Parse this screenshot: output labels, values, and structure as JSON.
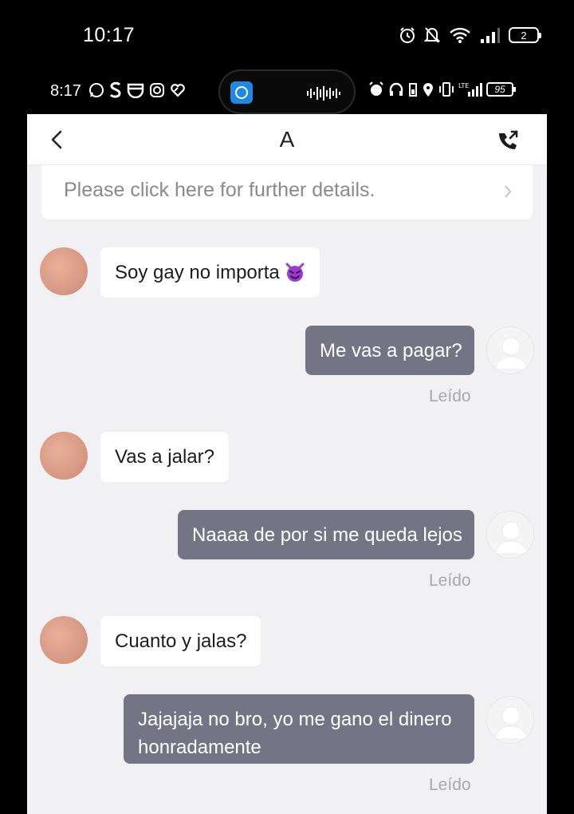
{
  "outer_status": {
    "time": "10:17",
    "battery_level": "2"
  },
  "inner_status": {
    "time": "8:17",
    "battery_level": "95"
  },
  "header": {
    "title": "A"
  },
  "notice": {
    "text": "Please click here for further details."
  },
  "messages": [
    {
      "direction": "in",
      "text": "Soy gay no importa",
      "emoji": "smiling-imp-emoji"
    },
    {
      "direction": "out",
      "text": "Me vas a pagar?",
      "status": "Leído"
    },
    {
      "direction": "in",
      "text": "Vas a jalar?"
    },
    {
      "direction": "out",
      "text": "Naaaa de por si me queda lejos",
      "status": "Leído"
    },
    {
      "direction": "in",
      "text": "Cuanto y jalas?"
    },
    {
      "direction": "out",
      "text": "Jajajaja no bro, yo me gano el dinero honradamente",
      "status": "Leído"
    }
  ],
  "colors": {
    "outgoing_bubble": "#747584",
    "incoming_bubble": "#ffffff",
    "background": "#f1f1f3"
  }
}
